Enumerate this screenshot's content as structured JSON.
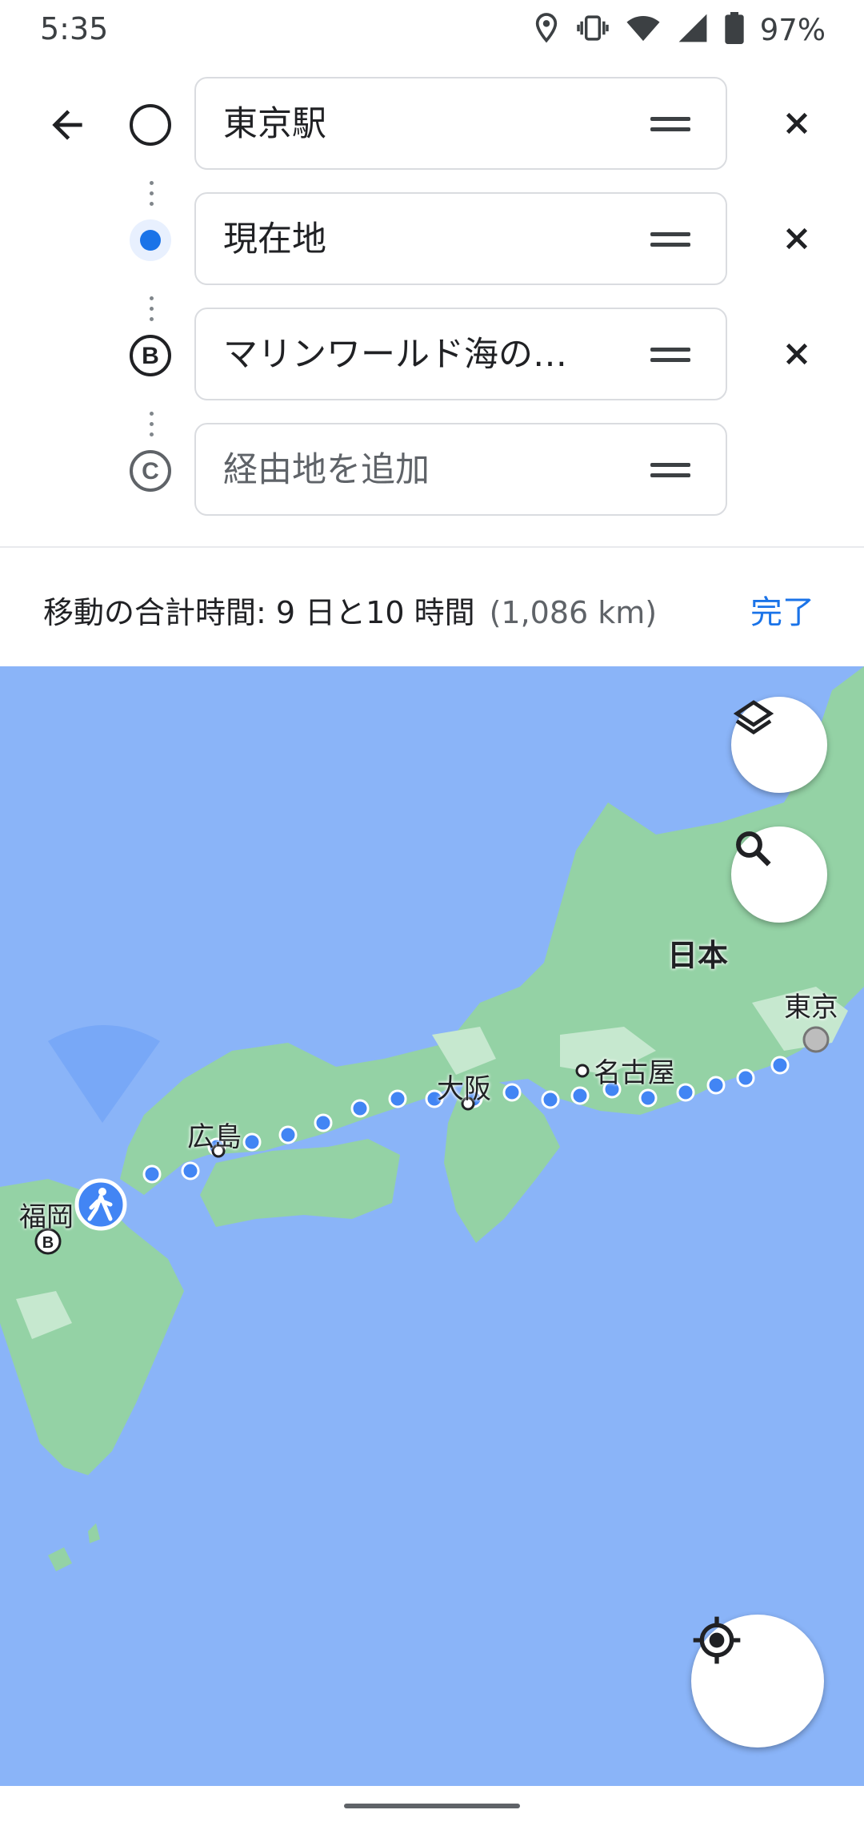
{
  "status_bar": {
    "time": "5:35",
    "battery": "97%"
  },
  "route": {
    "stops": [
      {
        "marker": "circle",
        "value": "東京駅"
      },
      {
        "marker": "current-location",
        "value": "現在地"
      },
      {
        "marker": "B",
        "value": "マリンワールド海の…"
      },
      {
        "marker": "C",
        "placeholder": "経由地を追加"
      }
    ]
  },
  "summary": {
    "text": "移動の合計時間: 9 日と10 時間",
    "distance": "(1,086 km)",
    "done_label": "完了"
  },
  "map": {
    "labels": {
      "japan": "日本",
      "tokyo": "東京",
      "nagoya": "名古屋",
      "osaka": "大阪",
      "hiroshima": "広島",
      "fukuoka": "福岡"
    },
    "colors": {
      "water": "#8ab4f8",
      "land": "#94d2a5",
      "route": "#4285f4"
    }
  }
}
